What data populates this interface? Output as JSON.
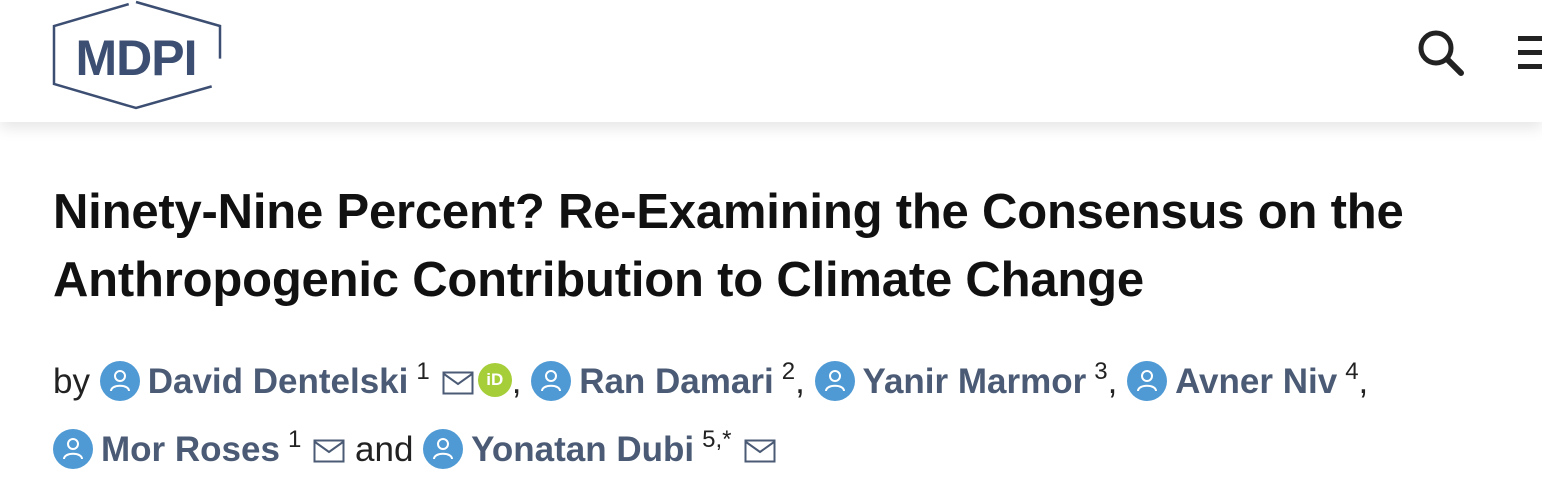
{
  "header": {
    "logo_text": "MDPI",
    "icons": [
      "search-icon",
      "menu-icon"
    ]
  },
  "article": {
    "title_line1": "Ninety-Nine Percent? Re-Examining the Consensus on the",
    "title_line2": "Anthropogenic Contribution to Climate Change",
    "by_label": "by",
    "and_label": "and",
    "authors": [
      {
        "name": "David Dentelski",
        "affiliation": "1",
        "email": true,
        "orcid": true
      },
      {
        "name": "Ran Damari",
        "affiliation": "2",
        "email": false,
        "orcid": false
      },
      {
        "name": "Yanir Marmor",
        "affiliation": "3",
        "email": false,
        "orcid": false
      },
      {
        "name": "Avner Niv",
        "affiliation": "4",
        "email": false,
        "orcid": false
      },
      {
        "name": "Mor Roses",
        "affiliation": "1",
        "email": true,
        "orcid": false
      },
      {
        "name": "Yonatan Dubi",
        "affiliation": "5,*",
        "email": true,
        "orcid": false
      }
    ],
    "orcid_label": "iD",
    "separator": ","
  },
  "colors": {
    "logo": "#3c4e72",
    "author_link": "#4b5b75",
    "avatar": "#4f9ad4",
    "orcid": "#a6ce39"
  }
}
